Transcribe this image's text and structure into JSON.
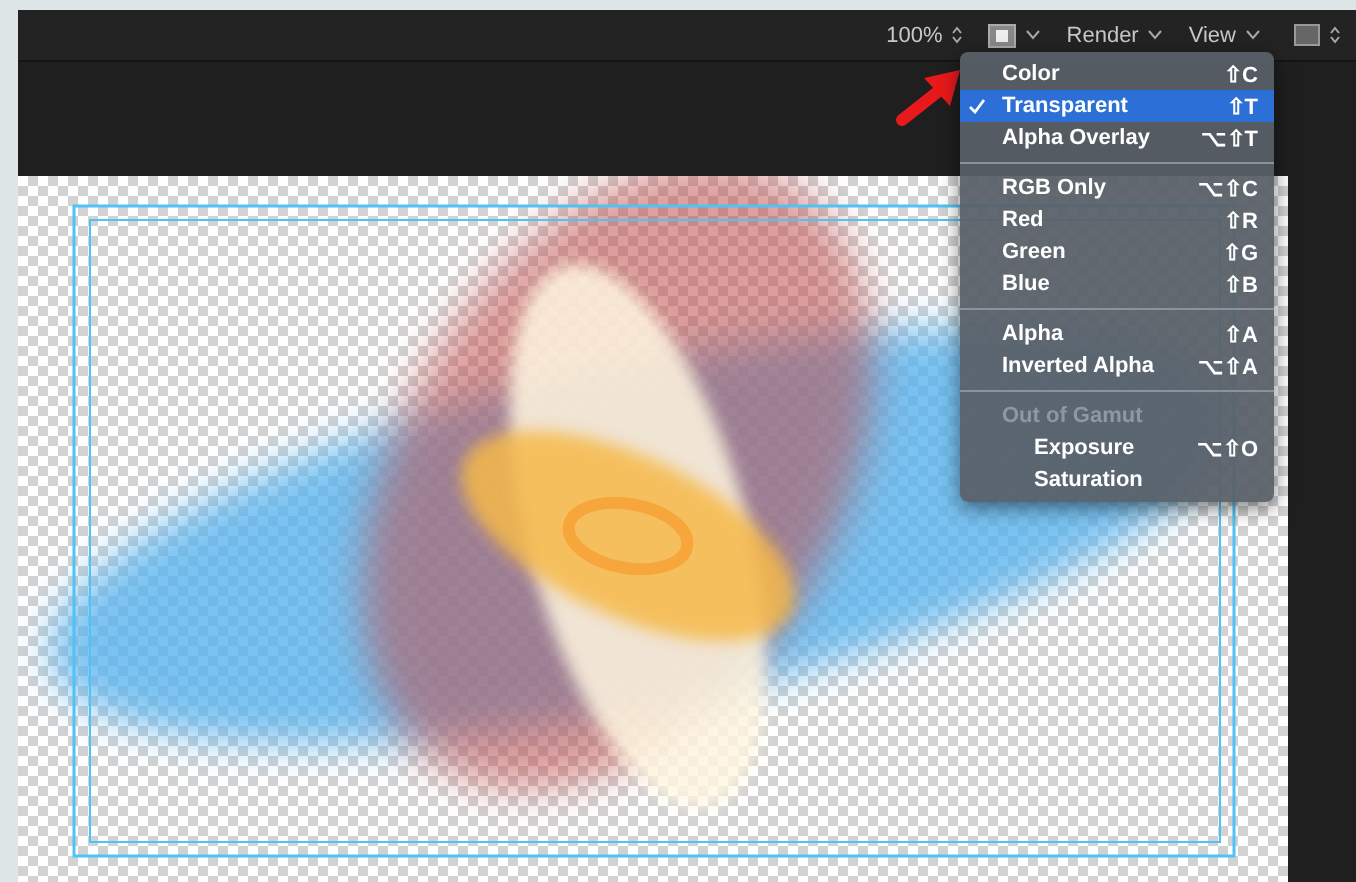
{
  "toolbar": {
    "zoom": "100%",
    "render_menu": "Render",
    "view_menu": "View"
  },
  "menu": {
    "sections": [
      [
        {
          "kind": "item",
          "label": "Color",
          "shortcut": "⇧C",
          "checked": false,
          "selected": false
        },
        {
          "kind": "item",
          "label": "Transparent",
          "shortcut": "⇧T",
          "checked": true,
          "selected": true
        },
        {
          "kind": "item",
          "label": "Alpha Overlay",
          "shortcut": "⌥⇧T",
          "checked": false,
          "selected": false
        }
      ],
      [
        {
          "kind": "item",
          "label": "RGB Only",
          "shortcut": "⌥⇧C",
          "checked": false,
          "selected": false
        },
        {
          "kind": "item",
          "label": "Red",
          "shortcut": "⇧R",
          "checked": false,
          "selected": false
        },
        {
          "kind": "item",
          "label": "Green",
          "shortcut": "⇧G",
          "checked": false,
          "selected": false
        },
        {
          "kind": "item",
          "label": "Blue",
          "shortcut": "⇧B",
          "checked": false,
          "selected": false
        }
      ],
      [
        {
          "kind": "item",
          "label": "Alpha",
          "shortcut": "⇧A",
          "checked": false,
          "selected": false
        },
        {
          "kind": "item",
          "label": "Inverted Alpha",
          "shortcut": "⌥⇧A",
          "checked": false,
          "selected": false
        }
      ],
      [
        {
          "kind": "header",
          "label": "Out of Gamut"
        },
        {
          "kind": "subitem",
          "label": "Exposure",
          "shortcut": "⌥⇧O",
          "checked": false,
          "selected": false
        },
        {
          "kind": "subitem",
          "label": "Saturation",
          "checked": false,
          "selected": false
        }
      ]
    ]
  }
}
